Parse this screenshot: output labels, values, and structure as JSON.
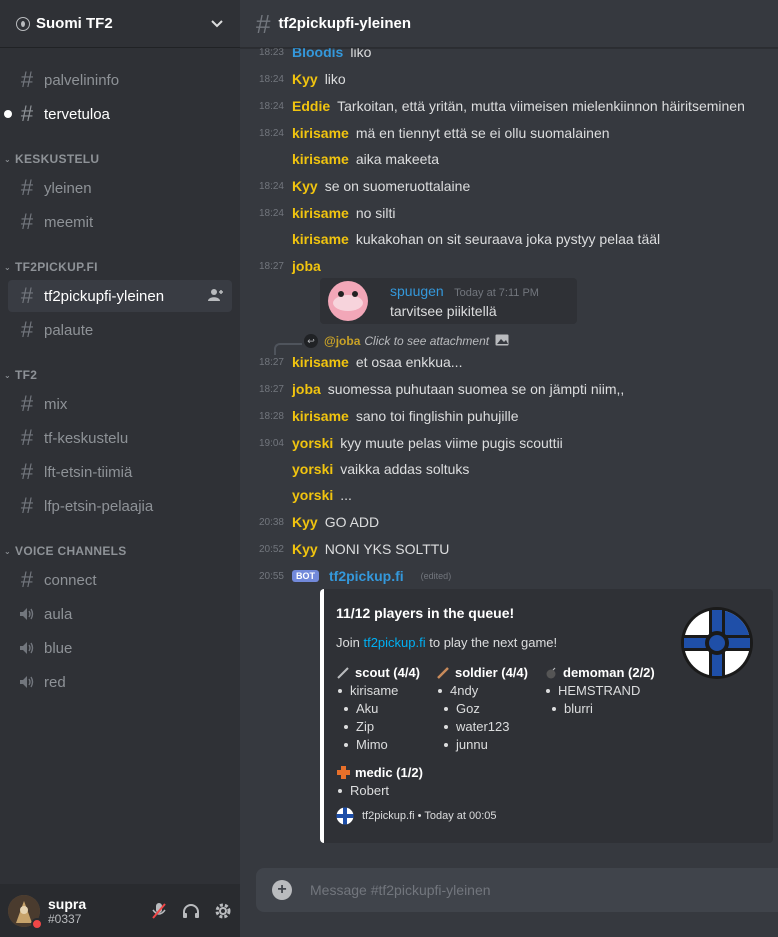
{
  "guild": {
    "name": "Suomi TF2"
  },
  "channels": {
    "top": [
      {
        "name": "palvelininfo"
      },
      {
        "name": "tervetuloa"
      }
    ],
    "categories": [
      {
        "label": "KESKUSTELU",
        "items": [
          "yleinen",
          "meemit"
        ]
      },
      {
        "label": "TF2PICKUP.FI",
        "items": [
          "tf2pickupfi-yleinen",
          "palaute"
        ]
      },
      {
        "label": "TF2",
        "items": [
          "mix",
          "tf-keskustelu",
          "lft-etsin-tiimiä",
          "lfp-etsin-pelaajia"
        ]
      },
      {
        "label": "VOICE CHANNELS",
        "items": [
          "connect",
          "aula",
          "blue",
          "red"
        ]
      }
    ]
  },
  "user": {
    "name": "supra",
    "tag": "#0337"
  },
  "header": {
    "channel": "tf2pickupfi-yleinen"
  },
  "messages": [
    {
      "ts": "18:23",
      "author": "Bloodis",
      "text": "liko"
    },
    {
      "ts": "18:24",
      "author": "Kyy",
      "text": "liko"
    },
    {
      "ts": "18:24",
      "author": "Eddie",
      "text": "Tarkoitan, että yritän, mutta viimeisen mielenkiinnon häiritseminen"
    },
    {
      "ts": "18:24",
      "author": "kirisame",
      "text": "mä en tiennyt että se ei ollu suomalainen"
    },
    {
      "ts": "",
      "author": "kirisame",
      "text": "aika makeeta"
    },
    {
      "ts": "18:24",
      "author": "Kyy",
      "text": "se on suomeruottalaine"
    },
    {
      "ts": "18:24",
      "author": "kirisame",
      "text": "no silti"
    },
    {
      "ts": "",
      "author": "kirisame",
      "text": "kukakohan on sit seuraava joka pystyy pelaa tääl"
    },
    {
      "ts": "18:27",
      "author": "joba",
      "text": ""
    },
    {
      "ts": "18:27",
      "author": "kirisame",
      "text": "et osaa enkkua..."
    },
    {
      "ts": "18:27",
      "author": "joba",
      "text": "suomessa puhutaan suomea se on jämpti niim,,"
    },
    {
      "ts": "18:28",
      "author": "kirisame",
      "text": "sano toi finglishin puhujille"
    },
    {
      "ts": "19:04",
      "author": "yorski",
      "text": "kyy muute pelas viime pugis scouttii"
    },
    {
      "ts": "",
      "author": "yorski",
      "text": "vaikka addas soltuks"
    },
    {
      "ts": "",
      "author": "yorski",
      "text": "..."
    },
    {
      "ts": "20:38",
      "author": "Kyy",
      "text": "GO ADD"
    },
    {
      "ts": "20:52",
      "author": "Kyy",
      "text": "NONI YKS SOLTTU"
    }
  ],
  "quote": {
    "author": "spuugen",
    "ts": "Today at 7:11 PM",
    "text": "tarvitsee  piikitellä"
  },
  "reply": {
    "author": "@joba",
    "text": "Click to see attachment"
  },
  "bot_message": {
    "ts": "20:55",
    "tag": "BOT",
    "author": "tf2pickup.fi",
    "edited": "(edited)"
  },
  "embed": {
    "title": "11/12 players in the queue!",
    "desc_pre": "Join ",
    "desc_link": "tf2pickup.fi",
    "desc_post": " to play the next game!",
    "fields": [
      {
        "name": "scout (4/4)",
        "players": [
          "kirisame",
          "Aku",
          "Zip",
          "Mimo"
        ]
      },
      {
        "name": "soldier (4/4)",
        "players": [
          "4ndy",
          "Goz",
          "water123",
          "junnu"
        ]
      },
      {
        "name": "demoman (2/2)",
        "players": [
          "HEMSTRAND",
          "blurri"
        ]
      },
      {
        "name": "medic (1/2)",
        "players": [
          "Robert"
        ]
      }
    ],
    "footer": "tf2pickup.fi • Today at 00:05"
  },
  "composer": {
    "placeholder": "Message #tf2pickupfi-yleinen"
  },
  "colors": {
    "author_yellow": "#f1c40f",
    "author_blue": "#3498db",
    "link": "#00b0f4",
    "bot_tag": "#7289da",
    "dnd": "#f04747"
  }
}
